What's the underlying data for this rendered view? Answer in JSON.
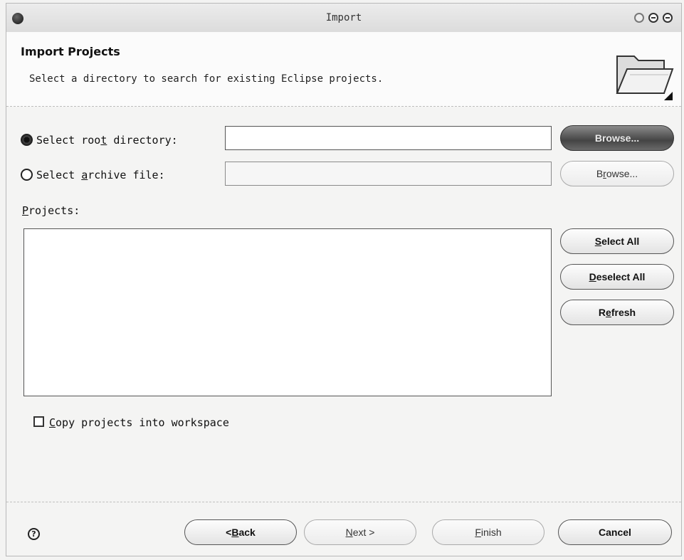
{
  "window": {
    "title": "Import",
    "controls": [
      "minimize-icon",
      "maximize-icon",
      "close-icon"
    ]
  },
  "header": {
    "title": "Import Projects",
    "description": "Select a directory to search for existing Eclipse projects.",
    "icon": "folder-icon"
  },
  "source": {
    "root_directory": {
      "label_before": "Select roo",
      "label_mnemonic": "t",
      "label_after": " directory:",
      "selected": true,
      "value": "",
      "browse_label": "Browse..."
    },
    "archive_file": {
      "label_before": "Select ",
      "label_mnemonic": "a",
      "label_after": "rchive file:",
      "selected": false,
      "value": "",
      "browse_label_before": "B",
      "browse_label_mnemonic": "r",
      "browse_label_after": "owse..."
    }
  },
  "projects": {
    "label_mnemonic": "P",
    "label_rest": "rojects:",
    "items": [],
    "buttons": {
      "select_all": {
        "mnemonic": "S",
        "rest": "elect All"
      },
      "deselect_all": {
        "mnemonic": "D",
        "rest": "eselect All"
      },
      "refresh": {
        "before": "R",
        "mnemonic": "e",
        "after": "fresh"
      }
    }
  },
  "options": {
    "copy_projects": {
      "mnemonic": "C",
      "rest": "opy projects into workspace",
      "checked": false
    }
  },
  "footer": {
    "help_icon": "help-icon",
    "back": {
      "before": "< ",
      "mnemonic": "B",
      "after": "ack"
    },
    "next": {
      "mnemonic": "N",
      "after": "ext >"
    },
    "finish": {
      "mnemonic": "F",
      "after": "inish"
    },
    "cancel": "Cancel"
  }
}
